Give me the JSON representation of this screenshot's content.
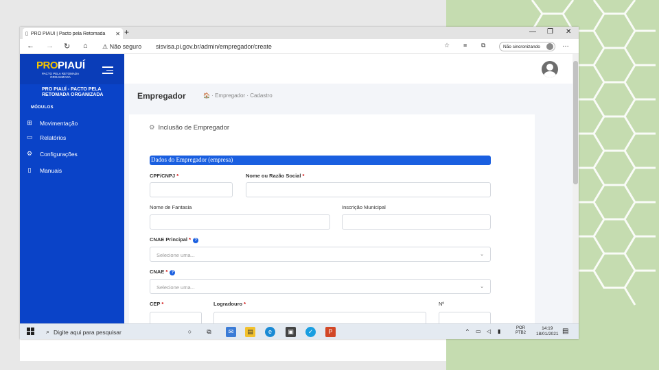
{
  "browser": {
    "tab_title": "PRO PIAUÍ | Pacto pela Retomada",
    "tab_close": "✕",
    "new_tab": "+",
    "security_warning": "⚠ Não seguro",
    "url": "sisvisa.pi.gov.br/admin/empregador/create",
    "sync_label": "Não sincronizando",
    "more_icon": "…"
  },
  "sidebar": {
    "logo_pro": "PRO",
    "logo_piaui": "PIAUÍ",
    "logo_tagline": "PACTO PELA RETOMADA ORGANIZADA",
    "org_title_line1": "PRO PIAUÍ - PACTO PELA",
    "org_title_line2": "RETOMADA ORGANIZADA",
    "section_label": "MÓDULOS",
    "items": [
      {
        "label": "Movimentação",
        "icon": "chart-icon"
      },
      {
        "label": "Relatórios",
        "icon": "report-icon"
      },
      {
        "label": "Configurações",
        "icon": "settings-icon"
      },
      {
        "label": "Manuais",
        "icon": "book-icon"
      }
    ]
  },
  "page": {
    "title": "Empregador",
    "breadcrumb": "🏠  ·  Empregador  ·  Cadastro"
  },
  "form": {
    "card_title": "Inclusão de Empregador",
    "section_title": "Dados do Empregador (empresa)",
    "cpf_cnpj_label": "CPF/CNPJ",
    "razao_label": "Nome ou Razão Social",
    "fantasia_label": "Nome de Fantasia",
    "inscricao_label": "Inscrição Municipal",
    "cnae_principal_label": "CNAE Principal",
    "cnae_principal_placeholder": "Selecione uma...",
    "cnae_label": "CNAE",
    "cnae_placeholder": "Selecione uma...",
    "cep_label": "CEP",
    "logradouro_label": "Logradouro",
    "numero_label": "Nº",
    "required_mark": "*",
    "help_mark": "?"
  },
  "taskbar": {
    "search_placeholder": "Digite aqui para pesquisar",
    "lang_line1": "POR",
    "lang_line2": "PTB2",
    "time": "14:19",
    "date": "18/01/2021"
  },
  "colors": {
    "sidebar": "#0a43c8",
    "section_bar": "#1a5fe0",
    "green_panel": "#c5dcb0"
  }
}
